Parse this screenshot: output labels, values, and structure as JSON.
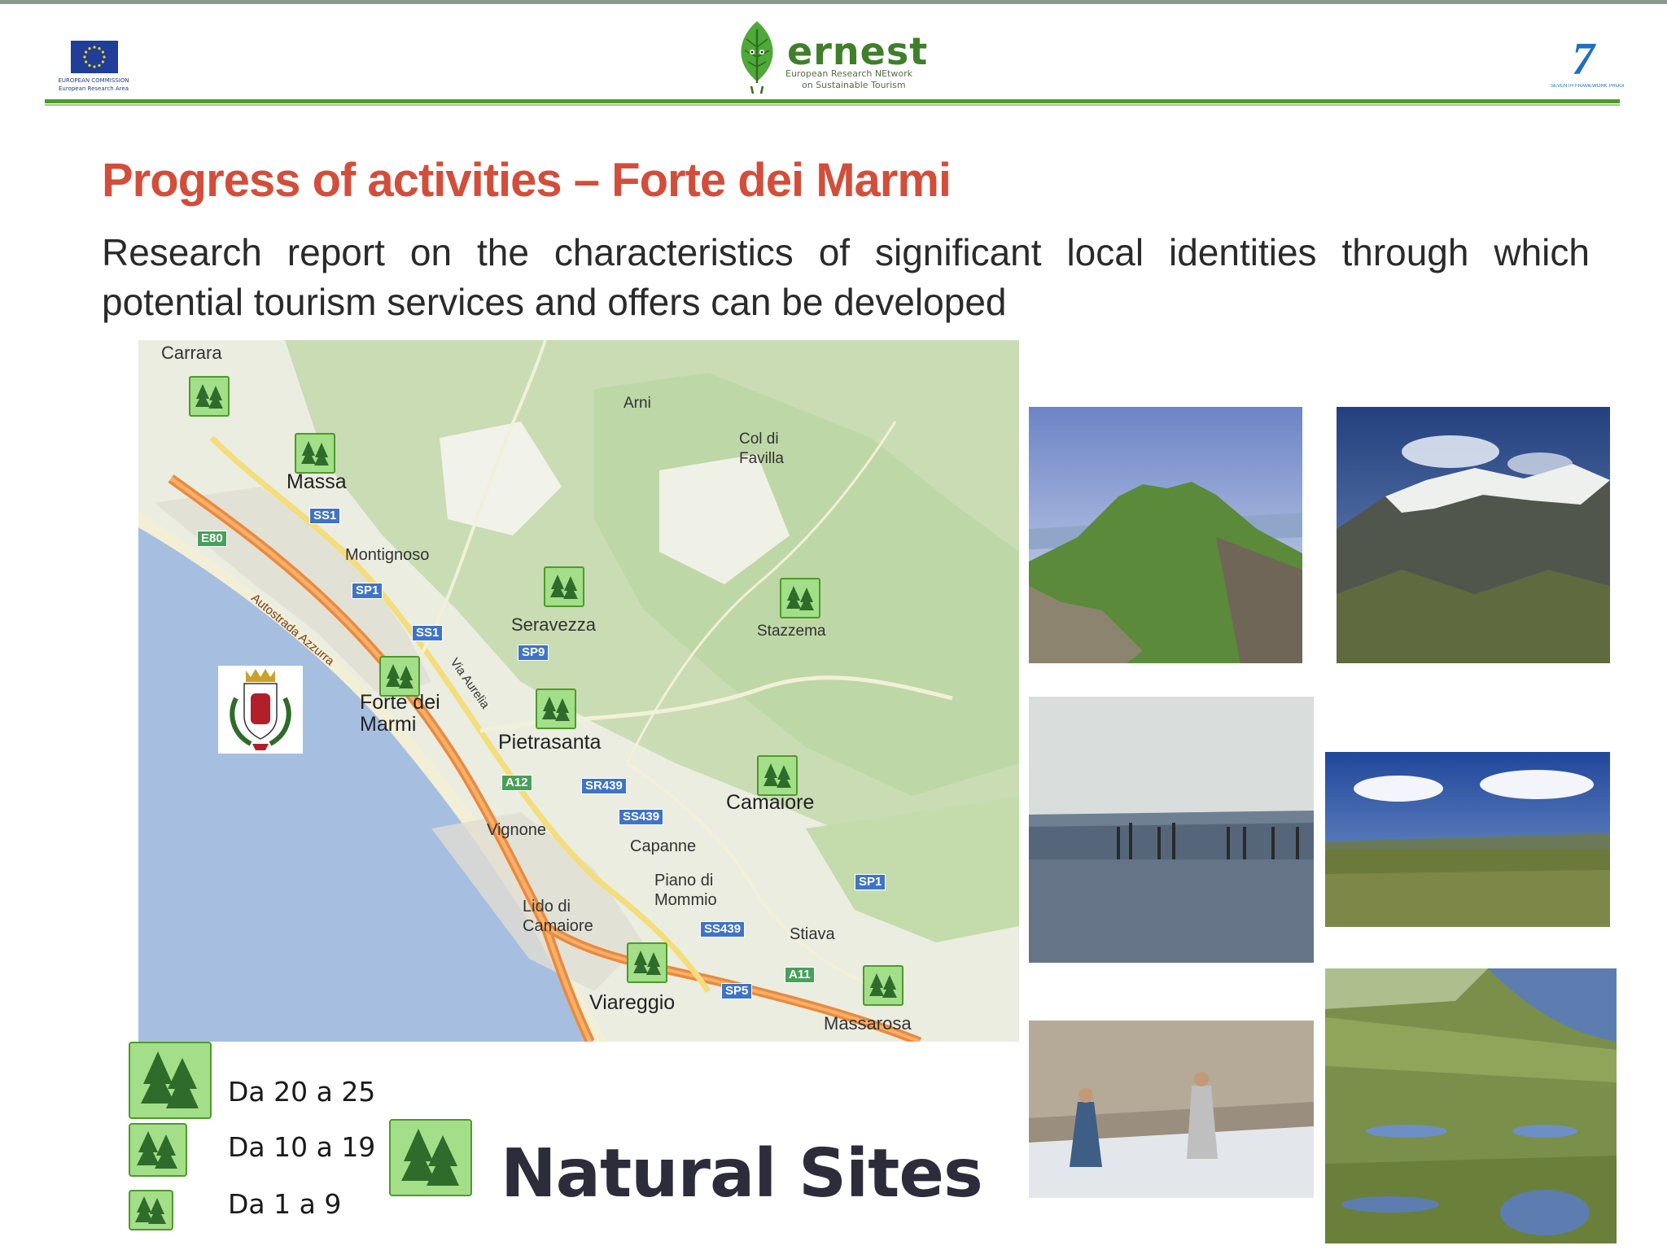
{
  "header": {
    "eu_logo_line1": "EUROPEAN COMMISSION",
    "eu_logo_line2": "European Research Area",
    "ernest_name": "ernest",
    "ernest_sub1": "European Research NEtwork",
    "ernest_sub2": "on Sustainable Tourism",
    "fp7_number": "7",
    "fp7_text": "SEVENTH FRAMEWORK PROGRAMME"
  },
  "slide": {
    "title": "Progress of activities – Forte dei Marmi",
    "subtitle": "Research report on the characteristics of significant local identities through which  potential tourism services and offers can be developed"
  },
  "map": {
    "places": {
      "carrara": "Carrara",
      "arni": "Arni",
      "col_di_favilla": "Col di\nFavilla",
      "massa": "Massa",
      "montignoso": "Montignoso",
      "seravezza": "Seravezza",
      "stazzema": "Stazzema",
      "forte_dei_marmi": "Forte dei\nMarmi",
      "pietrasanta": "Pietrasanta",
      "camaiore": "Camaiore",
      "vignone": "Vignone",
      "capanne": "Capanne",
      "piano_di_mommio": "Piano di\nMommio",
      "lido_di_camaiore": "Lido di\nCamaiore",
      "stiava": "Stiava",
      "viareggio": "Viareggio",
      "massarosa": "Massarosa"
    },
    "roads": {
      "ss1_a": "SS1",
      "e80": "E80",
      "sp1_a": "SP1",
      "ss1_b": "SS1",
      "sp9": "SP9",
      "a12": "A12",
      "sr439": "SR439",
      "ss439_a": "SS439",
      "sp1_b": "SP1",
      "ss439_b": "SS439",
      "sp5": "SP5",
      "a11": "A11",
      "autostrada": "Autostrada Azzurra",
      "aurelia": "Via Aurelia"
    },
    "marker_icon": "tree-icon"
  },
  "legend": {
    "items": [
      {
        "label": "Da 20 a  25",
        "icon": "tree-icon"
      },
      {
        "label": "Da 10 a  19",
        "icon": "tree-icon"
      },
      {
        "label": "Da 1 a  9",
        "icon": "tree-icon"
      }
    ],
    "heading": "Natural Sites",
    "heading_icon": "tree-icon"
  },
  "colors": {
    "title": "#d24e3b",
    "accent_green": "#4f9a2c",
    "marker_fill": "#a3de88",
    "sea": "#a6bfe0"
  }
}
